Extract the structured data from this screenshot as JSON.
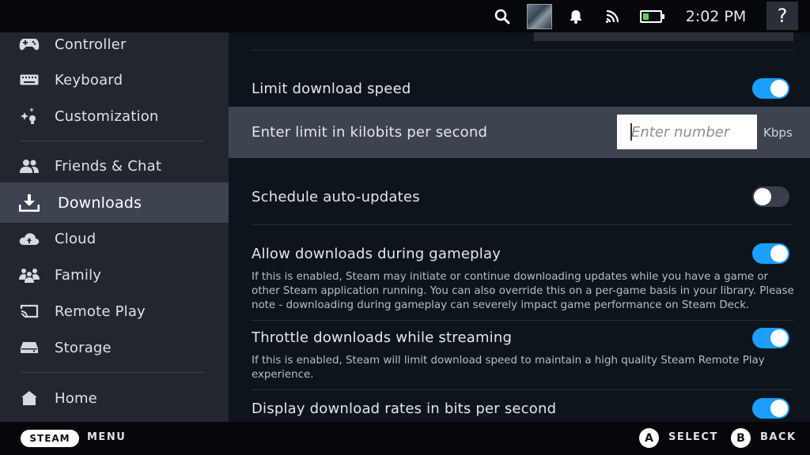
{
  "topbar": {
    "time": "2:02 PM",
    "help_label": "?"
  },
  "sidebar": {
    "items": [
      {
        "label": "Controller",
        "icon": "controller-icon"
      },
      {
        "label": "Keyboard",
        "icon": "keyboard-icon"
      },
      {
        "label": "Customization",
        "icon": "customization-icon"
      },
      {
        "label": "Friends & Chat",
        "icon": "friends-icon"
      },
      {
        "label": "Downloads",
        "icon": "download-icon",
        "active": true
      },
      {
        "label": "Cloud",
        "icon": "cloud-icon"
      },
      {
        "label": "Family",
        "icon": "family-icon"
      },
      {
        "label": "Remote Play",
        "icon": "remote-play-icon"
      },
      {
        "label": "Storage",
        "icon": "storage-icon"
      },
      {
        "label": "Home",
        "icon": "home-icon"
      }
    ]
  },
  "settings": {
    "limit_speed": {
      "label": "Limit download speed",
      "enabled": true
    },
    "limit_kbps": {
      "label": "Enter limit in kilobits per second",
      "placeholder": "Enter number",
      "unit": "Kbps"
    },
    "schedule": {
      "label": "Schedule auto-updates",
      "enabled": false
    },
    "allow_gameplay": {
      "label": "Allow downloads during gameplay",
      "enabled": true,
      "desc": "If this is enabled, Steam may initiate or continue downloading updates while you have a game or other Steam application running. You can also override this on a per-game basis in your library. Please note - downloading during gameplay can severely impact game performance on Steam Deck."
    },
    "throttle": {
      "label": "Throttle downloads while streaming",
      "enabled": true,
      "desc": "If this is enabled, Steam will limit download speed to maintain a high quality Steam Remote Play experience."
    },
    "bits": {
      "label": "Display download rates in bits per second",
      "enabled": true
    }
  },
  "bottombar": {
    "steam_label": "STEAM",
    "menu_label": "MENU",
    "a_glyph": "A",
    "select_label": "SELECT",
    "b_glyph": "B",
    "back_label": "BACK"
  },
  "colors": {
    "accent": "#1a9fff",
    "sidebar_bg": "#23262e",
    "active_bg": "#3d4450",
    "content_bg": "#0e141b"
  }
}
